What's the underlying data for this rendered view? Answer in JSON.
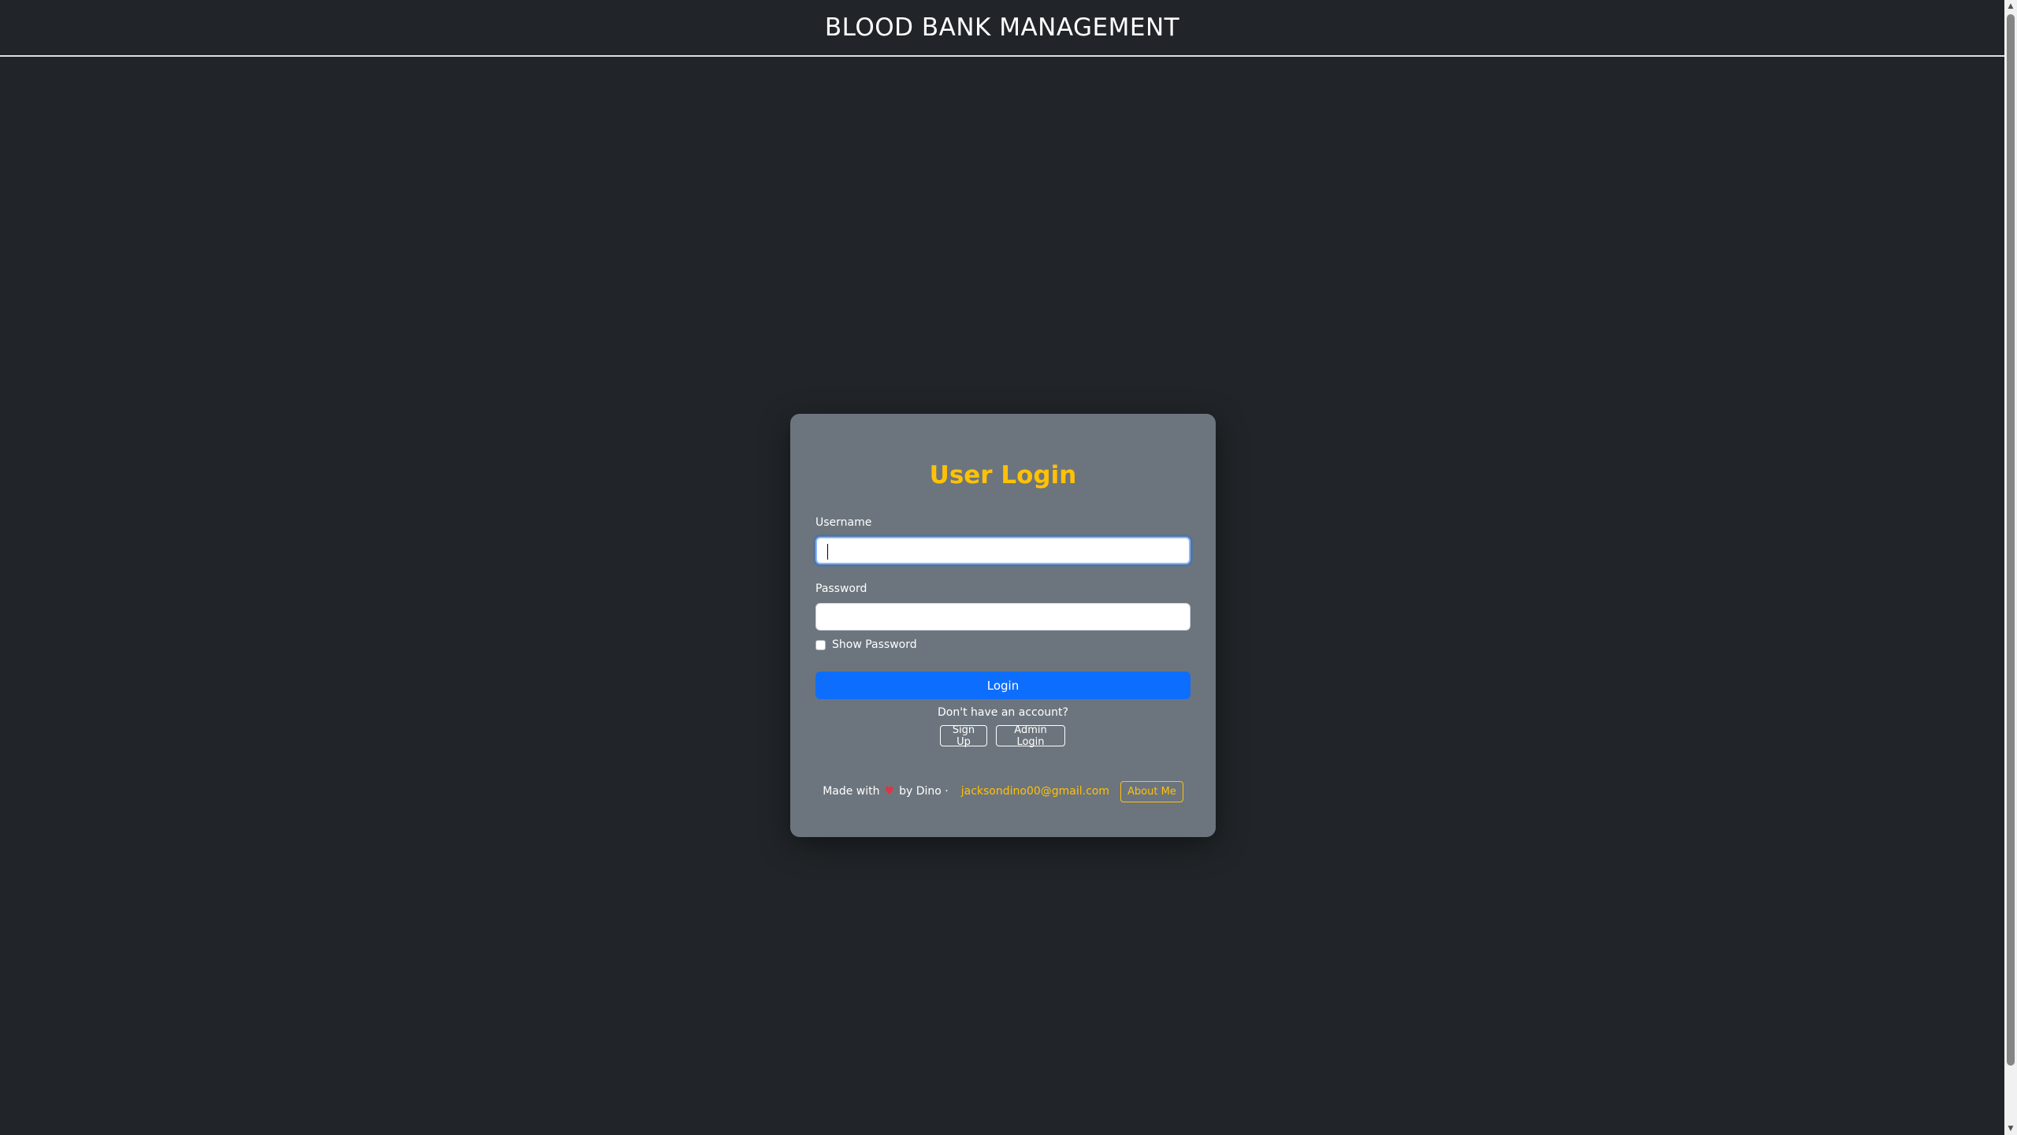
{
  "header": {
    "title": "BLOOD BANK MANAGEMENT"
  },
  "login_card": {
    "title": "User Login",
    "username_label": "Username",
    "username_value": "",
    "password_label": "Password",
    "password_value": "",
    "show_password_label": "Show Password",
    "show_password_checked": false,
    "login_label": "Login",
    "no_account_text": "Don't have an account?",
    "signup_label": "Sign Up",
    "admin_login_label": "Admin Login"
  },
  "footer": {
    "made_with": "Made with",
    "heart_icon": "heart-icon",
    "by_text": "by Dino ·",
    "email": "jacksondino00@gmail.com",
    "about_label": "About Me"
  },
  "colors": {
    "background": "#212529",
    "card": "#6c757d",
    "accent": "#ffc107",
    "primary": "#0d6efd",
    "heart": "#dc3545"
  }
}
